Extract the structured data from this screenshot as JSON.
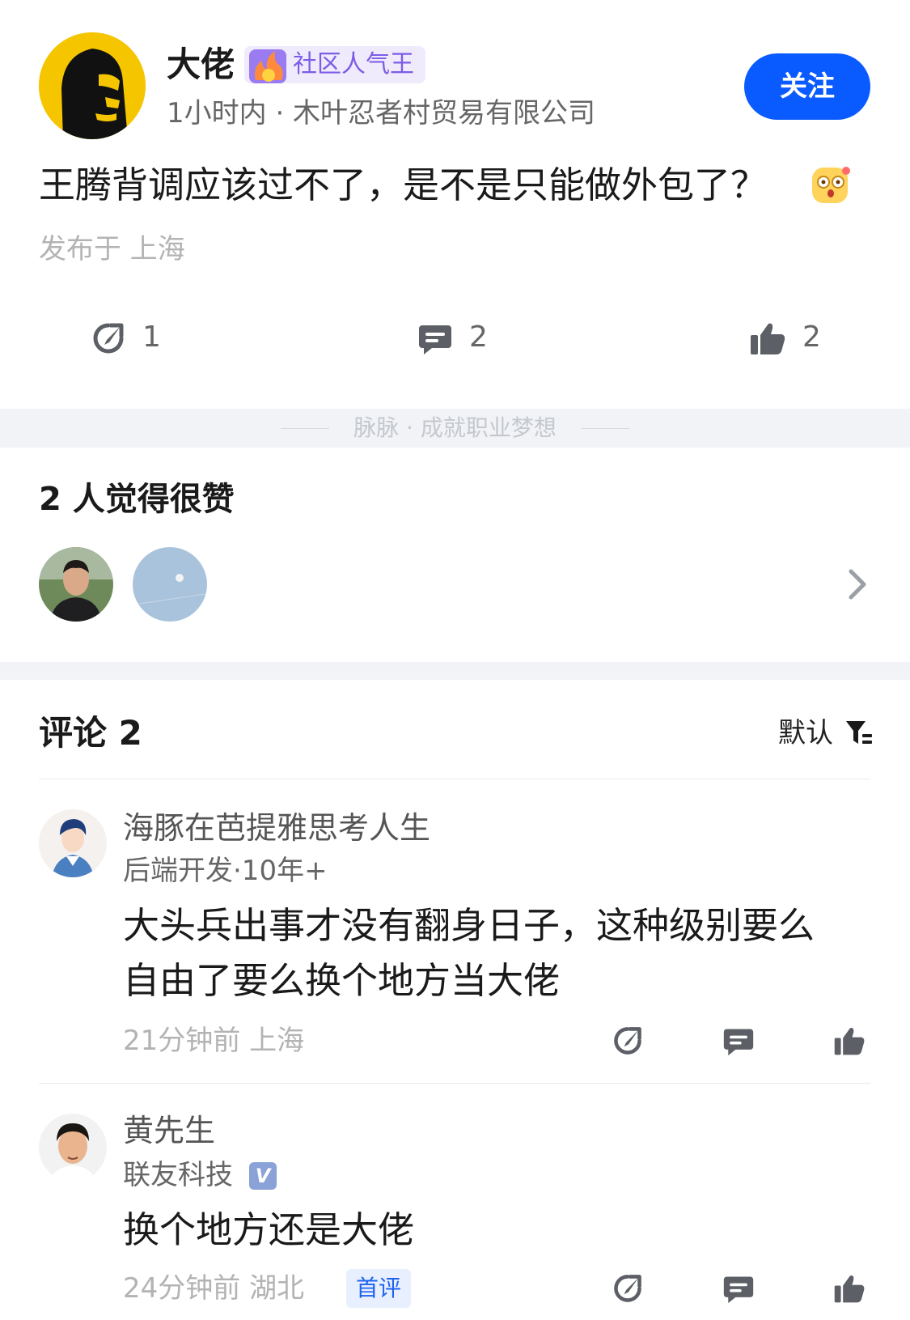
{
  "post": {
    "author": "大佬",
    "badge": "社区人气王",
    "meta": "1小时内 · 木叶忍者村贸易有限公司",
    "follow_label": "关注",
    "text": "王腾背调应该过不了，是不是只能做外包了？",
    "location": "发布于 上海",
    "actions": {
      "share_count": "1",
      "comment_count": "2",
      "like_count": "2"
    }
  },
  "divider": {
    "text": "脉脉 · 成就职业梦想"
  },
  "likes": {
    "title": "2 人觉得很赞"
  },
  "comments": {
    "title": "评论 2",
    "sort_label": "默认",
    "items": [
      {
        "name": "海豚在芭提雅思考人生",
        "subtitle": "后端开发·10年+",
        "text_line1": "大头兵出事才没有翻身日子，这种级别要么",
        "text_line2": "自由了要么换个地方当大佬",
        "meta": "21分钟前  上海"
      },
      {
        "name": "黄先生",
        "subtitle": "联友科技",
        "badge": "V",
        "text_line1": "换个地方还是大佬",
        "meta": "24分钟前  湖北",
        "tag": "首评"
      }
    ]
  },
  "colors": {
    "accent": "#0a5bff",
    "badge_bg": "#efeafc",
    "badge_text": "#7d5ce6",
    "muted": "#b3b3b3"
  },
  "icons": [
    "share-icon",
    "comment-icon",
    "thumbs-up-icon",
    "chevron-right-icon",
    "filter-icon",
    "fire-badge-icon",
    "surprised-emoji-icon"
  ]
}
